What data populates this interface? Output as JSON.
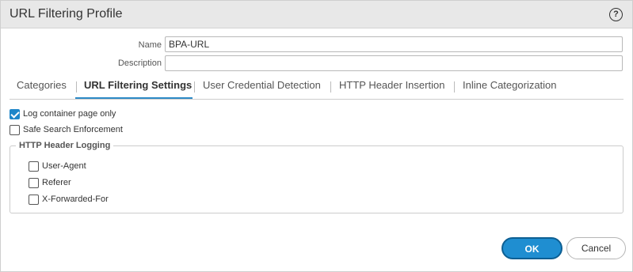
{
  "dialog": {
    "title": "URL Filtering Profile",
    "help_label": "?"
  },
  "form": {
    "name_label": "Name",
    "name_value": "BPA-URL",
    "description_label": "Description",
    "description_value": ""
  },
  "tabs": [
    {
      "label": "Categories",
      "active": false
    },
    {
      "label": "URL Filtering Settings",
      "active": true
    },
    {
      "label": "User Credential Detection",
      "active": false
    },
    {
      "label": "HTTP Header Insertion",
      "active": false
    },
    {
      "label": "Inline Categorization",
      "active": false
    }
  ],
  "settings": {
    "log_container_label": "Log container page only",
    "log_container_checked": true,
    "safe_search_label": "Safe Search Enforcement",
    "safe_search_checked": false
  },
  "header_logging": {
    "legend": "HTTP Header Logging",
    "items": [
      {
        "label": "User-Agent",
        "checked": false
      },
      {
        "label": "Referer",
        "checked": false
      },
      {
        "label": "X-Forwarded-For",
        "checked": false
      }
    ]
  },
  "buttons": {
    "ok_label": "OK",
    "cancel_label": "Cancel"
  },
  "colors": {
    "accent": "#1f8ed1",
    "tab_underline": "#2d8ac7",
    "titlebar": "#e8e8e8"
  }
}
